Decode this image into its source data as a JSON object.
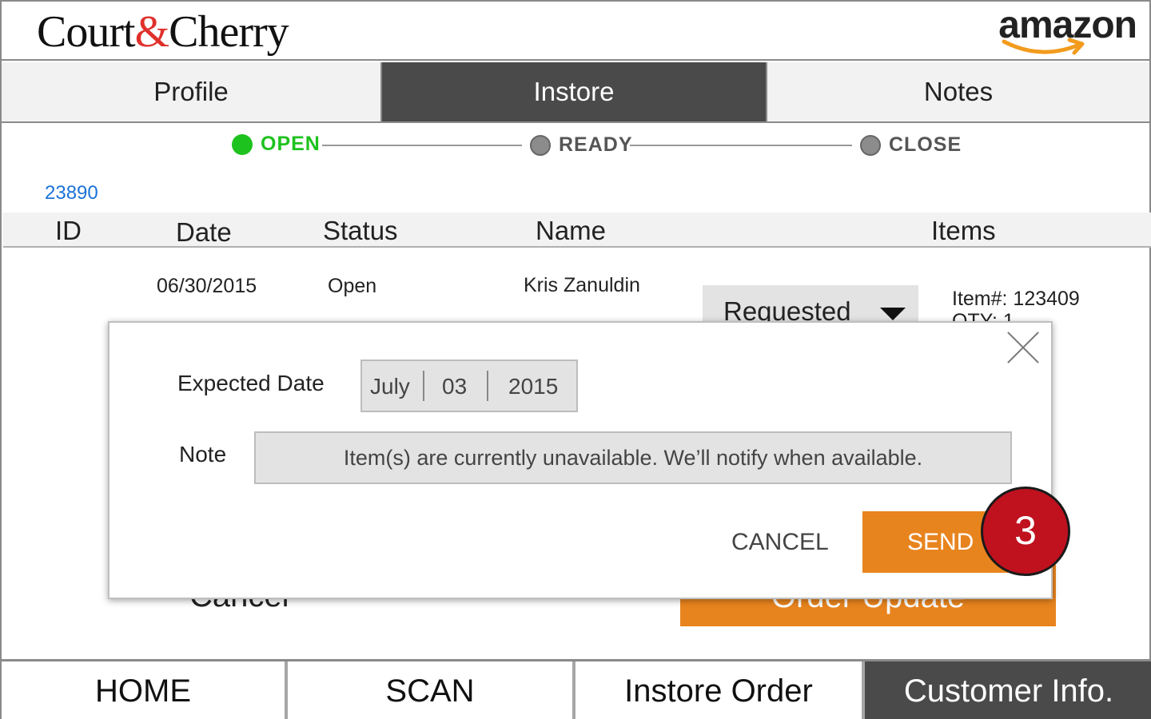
{
  "header": {
    "brand_left": "Court",
    "brand_amp": "&",
    "brand_right": "Cherry",
    "partner_logo": "amazon"
  },
  "tabs": [
    {
      "label": "Profile"
    },
    {
      "label": "Instore",
      "active": true
    },
    {
      "label": "Notes"
    }
  ],
  "progress": {
    "steps": [
      {
        "label": "OPEN",
        "state": "active",
        "color": "#1ec21e"
      },
      {
        "label": "READY",
        "state": "pending"
      },
      {
        "label": "CLOSE",
        "state": "pending"
      }
    ]
  },
  "order_number": "23890",
  "table": {
    "headers": [
      "ID",
      "Date",
      "Status",
      "Name",
      "Items"
    ],
    "row": {
      "date": "06/30/2015",
      "status": "Open",
      "name": "Kris Zanuldin",
      "item_status": "Requested",
      "item_number": "Item#: 123409",
      "qty": "QTY: 1"
    }
  },
  "background_actions": {
    "cancel": "Cancel",
    "update": "Order Update"
  },
  "modal": {
    "expected_date_label": "Expected Date",
    "month": "July",
    "day": "03",
    "year": "2015",
    "note_label": "Note",
    "note_value": "Item(s) are currently unavailable. We’ll notify when available.",
    "cancel_label": "CANCEL",
    "send_label": "SEND"
  },
  "step_badge": "3",
  "bottom_nav": [
    {
      "label": "HOME"
    },
    {
      "label": "SCAN"
    },
    {
      "label": "Instore Order"
    },
    {
      "label": "Customer Info.",
      "active": true
    }
  ],
  "colors": {
    "accent_orange": "#e8841e",
    "badge_red": "#c0111f",
    "link_blue": "#1a73d9",
    "active_dark": "#4a4a4a"
  }
}
